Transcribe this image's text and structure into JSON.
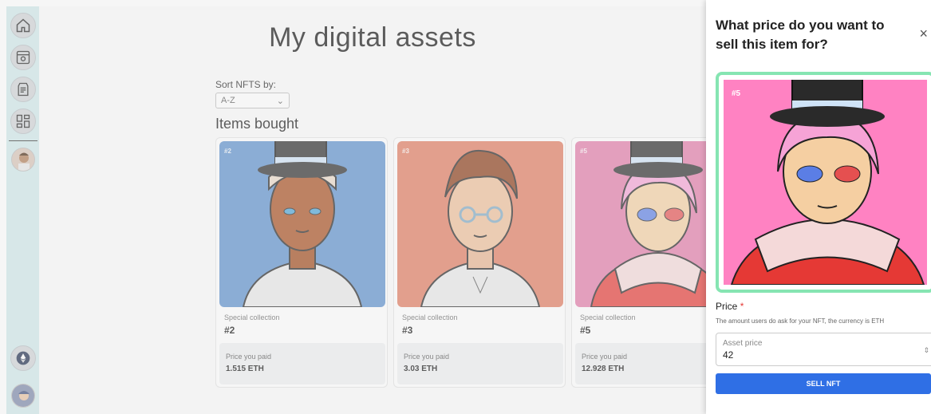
{
  "page": {
    "title": "My digital assets",
    "sort_label": "Sort NFTS by:",
    "sort_value": "A-Z",
    "section_title": "Items bought"
  },
  "sidebar": {
    "icons": [
      "home-icon",
      "store-icon",
      "wallet-icon",
      "dashboard-icon"
    ],
    "bottom_icons": [
      "ethereum-icon",
      "user-avatar"
    ]
  },
  "cards": [
    {
      "tag": "#2",
      "collection": "Special collection",
      "number": "#2",
      "paid_label": "Price you paid",
      "paid_value": "1.515 ETH",
      "bg": "#5b8fcd"
    },
    {
      "tag": "#3",
      "collection": "Special collection",
      "number": "#3",
      "paid_label": "Price you paid",
      "paid_value": "3.03 ETH",
      "bg": "#e07a5f"
    },
    {
      "tag": "#5",
      "collection": "Special collection",
      "number": "#5",
      "paid_label": "Price you paid",
      "paid_value": "12.928 ETH",
      "bg": "#e27aa8"
    }
  ],
  "modal": {
    "title": "What price do you want to sell this item for?",
    "close": "×",
    "preview_tag": "#5",
    "price_label": "Price",
    "required_mark": "*",
    "price_hint": "The amount users do ask for your NFT, the currency is ETH",
    "price_placeholder": "Asset price",
    "price_value": "42",
    "sell_button": "SELL NFT"
  },
  "colors": {
    "sidebar": "#cfe9ea",
    "accent": "#2f6fe5",
    "preview_border": "#86e5b2",
    "preview_bg": "#ff82c2"
  }
}
